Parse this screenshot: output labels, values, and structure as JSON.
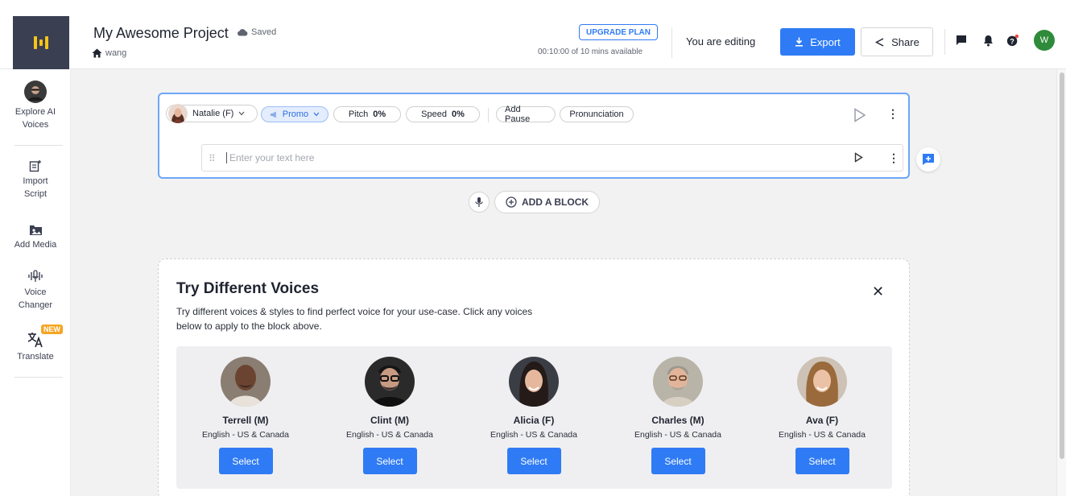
{
  "header": {
    "project_title": "My Awesome Project",
    "saved_label": "Saved",
    "breadcrumb": "wang",
    "upgrade_label": "UPGRADE PLAN",
    "minutes_available": "00:10:00 of 10 mins available",
    "editing_status": "You are editing",
    "export_label": "Export",
    "share_label": "Share",
    "user_initial": "W"
  },
  "sidebar": {
    "items": [
      {
        "label": "Explore AI Voices",
        "icon": "voice-avatar-icon"
      },
      {
        "label": "Import Script",
        "icon": "import-script-icon"
      },
      {
        "label": "Add Media",
        "icon": "add-media-icon"
      },
      {
        "label": "Voice Changer",
        "icon": "voice-changer-icon"
      },
      {
        "label": "Translate",
        "icon": "translate-icon",
        "badge": "NEW"
      }
    ]
  },
  "block": {
    "voice": "Natalie (F)",
    "style": "Promo",
    "pitch_label": "Pitch",
    "pitch_value": "0%",
    "speed_label": "Speed",
    "speed_value": "0%",
    "add_pause": "Add Pause",
    "pronunciation": "Pronunciation",
    "text_placeholder": "Enter your text here"
  },
  "add_block_label": "ADD A BLOCK",
  "try_voices": {
    "title": "Try Different Voices",
    "description": "Try different voices & styles to find perfect voice for your use-case. Click any voices below to apply to the block above.",
    "voices": [
      {
        "name": "Terrell (M)",
        "lang": "English - US & Canada",
        "select": "Select"
      },
      {
        "name": "Clint (M)",
        "lang": "English - US & Canada",
        "select": "Select"
      },
      {
        "name": "Alicia (F)",
        "lang": "English - US & Canada",
        "select": "Select"
      },
      {
        "name": "Charles (M)",
        "lang": "English - US & Canada",
        "select": "Select"
      },
      {
        "name": "Ava (F)",
        "lang": "English - US & Canada",
        "select": "Select"
      }
    ]
  },
  "colors": {
    "accent": "#2f7bf5",
    "logo_bg": "#3b3f52",
    "user_avatar": "#2e8b3a",
    "new_badge": "#f5a524"
  }
}
